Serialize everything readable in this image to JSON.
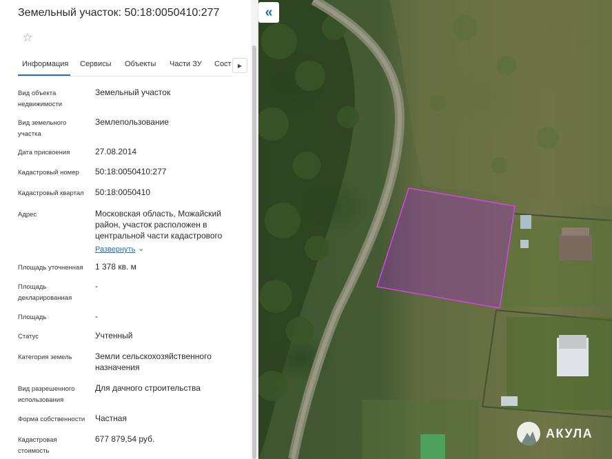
{
  "panel": {
    "title": "Земельный участок: 50:18:0050410:277",
    "tabs": [
      {
        "label": "Информация"
      },
      {
        "label": "Сервисы"
      },
      {
        "label": "Объекты"
      },
      {
        "label": "Части ЗУ"
      },
      {
        "label": "Соста"
      }
    ],
    "fields": [
      {
        "label": "Вид объекта недвижимости",
        "value": "Земельный участок"
      },
      {
        "label": "Вид земельного участка",
        "value": "Землепользование"
      },
      {
        "label": "Дата присвоения",
        "value": "27.08.2014"
      },
      {
        "label": "Кадастровый номер",
        "value": "50:18:0050410:277"
      },
      {
        "label": "Кадастровый квартал",
        "value": "50:18:0050410"
      },
      {
        "label": "Адрес",
        "value": "Московская область, Можайский район, участок расположен в центральной части кадастрового"
      },
      {
        "label": "Площадь уточненная",
        "value": "1 378 кв. м"
      },
      {
        "label": "Площадь декларированная",
        "value": "-"
      },
      {
        "label": "Площадь",
        "value": "-"
      },
      {
        "label": "Статус",
        "value": "Учтенный"
      },
      {
        "label": "Категория земель",
        "value": "Земли сельскохозяйственного назначения"
      },
      {
        "label": "Вид разрешенного использования",
        "value": "Для дачного строительства"
      },
      {
        "label": "Форма собственности",
        "value": "Частная"
      },
      {
        "label": "Кадастровая стоимость",
        "value": "677 879,54 руб."
      }
    ],
    "expand_label": "Развернуть"
  },
  "map": {
    "watermark": "АКУЛА",
    "parcel_color": "#c23ad6",
    "icons": {
      "collapse": "double-chevron-left-icon",
      "star": "star-outline-icon",
      "next": "triangle-right-icon",
      "expand": "chevron-down-icon"
    }
  }
}
